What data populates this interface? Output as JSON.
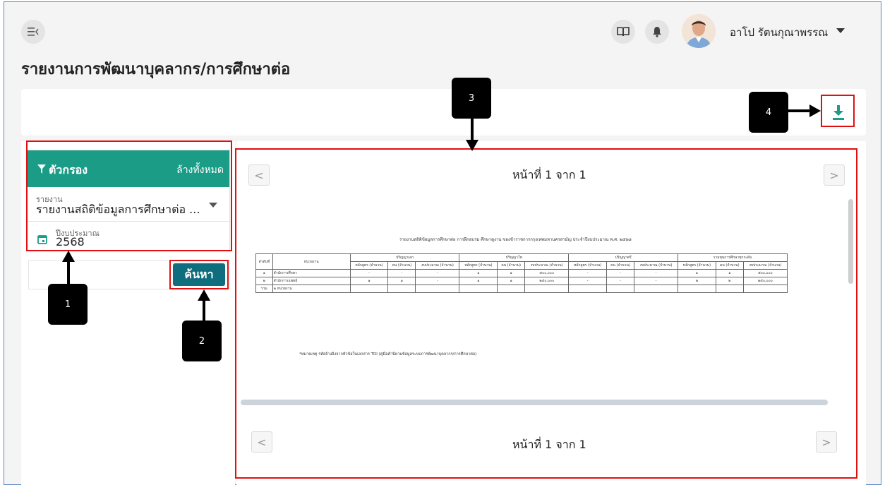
{
  "header": {
    "menu_icon": "collapse-menu-icon",
    "book_icon": "book-icon",
    "bell_icon": "bell-icon",
    "user_name": "อาโป รัตนกุณาพรรณ"
  },
  "page": {
    "title": "รายงานการพัฒนาบุคลากร/การศึกษาต่อ"
  },
  "filter": {
    "title": "ตัวกรอง",
    "clear_label": "ล้างทั้งหมด",
    "report_label": "รายงาน",
    "report_value": "รายงานสถิติข้อมูลการศึกษาต่อ ...",
    "year_label": "ปีงบประมาณ",
    "year_value": "2568",
    "search_label": "ค้นหา"
  },
  "viewer": {
    "page_indicator_top": "หน้าที่ 1 จาก 1",
    "page_indicator_bottom": "หน้าที่ 1 จาก 1",
    "prev_label": "<",
    "next_label": ">",
    "document": {
      "title": "รายงานสถิติข้อมูลการศึกษาต่อ การฝึกอบรม ศึกษาดูงาน ของข้าราชการกรุงเทพมหานครสามัญ ประจำปีงบประมาณ พ.ศ. ๒๕๖๘",
      "col_no": "ลำดับที่",
      "col_unit": "หน่วยงาน",
      "groups": [
        "ปริญญาเอก",
        "ปริญญาโท",
        "ปริญญาตรี",
        "รวมทุนการศึกษาทุกระดับ"
      ],
      "sub_headers": [
        "หลักสูตร (จำนวน)",
        "คน (จำนวน)",
        "งบประมาณ (จำนวน)"
      ],
      "rows": [
        {
          "no": "๑",
          "unit": "สำนักการศึกษา",
          "values": [
            "-",
            "-",
            "-",
            "๑",
            "๑",
            "๕๐๐,๐๐๐",
            "-",
            "-",
            "-",
            "๑",
            "๑",
            "๕๐๐,๐๐๐"
          ]
        },
        {
          "no": "๒",
          "unit": "สำนักการแพทย์",
          "values": [
            "๑",
            "๑",
            "-",
            "๑",
            "๑",
            "๒๕๐,๐๐๐",
            "-",
            "-",
            "-",
            "๒",
            "๒",
            "๒๕๐,๐๐๐"
          ]
        },
        {
          "no": "รวม",
          "unit": "๒ หน่วยงาน",
          "values": [
            "",
            "",
            "",
            "",
            "",
            "",
            "",
            "",
            "",
            "",
            "",
            ""
          ]
        }
      ],
      "note": "*หมายเหตุ รหัสอ้างอิงจากหัวข้อในเอกสาร TDI (คู่มือคำนิยามข้อมูลระบบการพัฒนาบุคลากร/การศึกษาต่อ)"
    }
  },
  "annotations": {
    "badge_1": "1",
    "badge_2": "2",
    "badge_3": "3",
    "badge_4": "4",
    "highlight_color": "#e01010"
  },
  "colors": {
    "filter_header": "#1a9c87",
    "search_button": "#0f6e7d",
    "download_icon": "#1a9c87"
  }
}
